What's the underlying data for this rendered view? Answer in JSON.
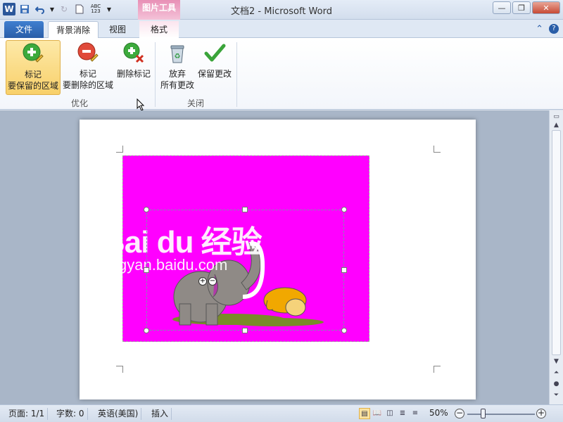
{
  "window": {
    "title": "文档2  -  Microsoft Word",
    "context_tab": "图片工具",
    "app_icon": "W",
    "spell_check_icon": "ABC 123"
  },
  "tabs": {
    "file": "文件",
    "background_removal": "背景消除",
    "view": "视图",
    "format": "格式"
  },
  "ribbon": {
    "mark_keep": {
      "line1": "标记",
      "line2": "要保留的区域"
    },
    "mark_remove": {
      "line1": "标记",
      "line2": "要删除的区域"
    },
    "delete_mark": {
      "line1": "删除标记"
    },
    "discard": {
      "line1": "放弃",
      "line2": "所有更改"
    },
    "keep_changes": {
      "line1": "保留更改"
    },
    "group_refine": "优化",
    "group_close": "关闭"
  },
  "document": {
    "image_watermark_line1": "Bai du 经验",
    "image_watermark_line2": "jingyan.baidu.com"
  },
  "statusbar": {
    "page": "页面: 1/1",
    "words": "字数: 0",
    "language": "英语(美国)",
    "mode": "插入",
    "zoom": "50%"
  },
  "colors": {
    "background_removal_fill": "#ff00ff",
    "accent": "#2b579a",
    "context_tab": "#e890b6"
  }
}
